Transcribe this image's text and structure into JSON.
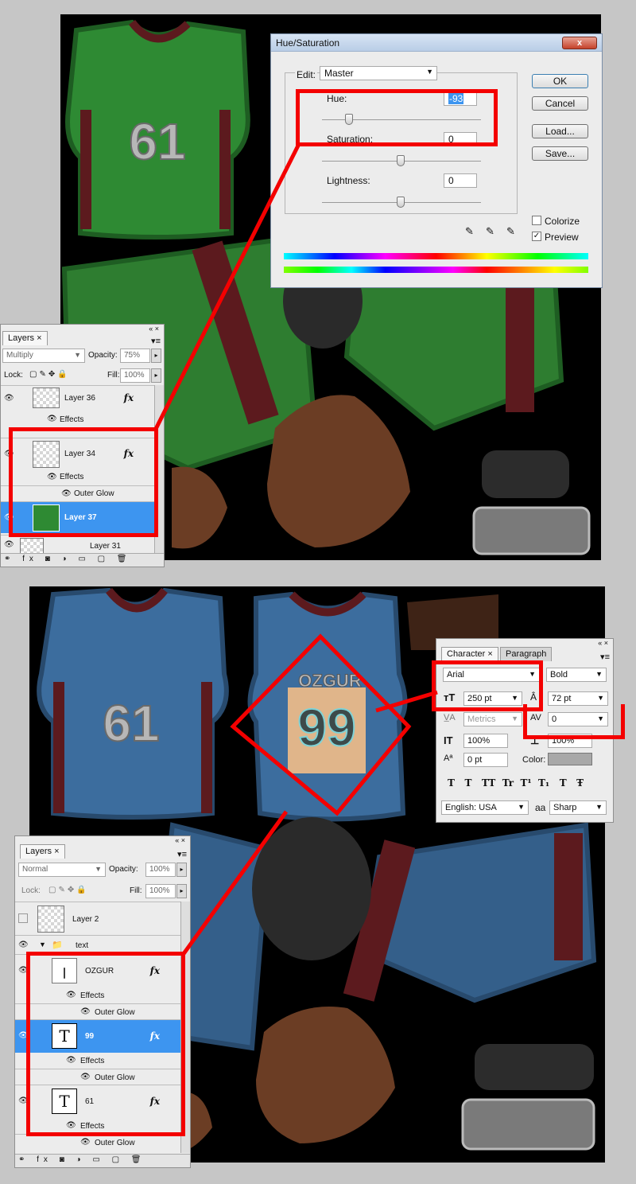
{
  "hue_sat": {
    "title": "Hue/Saturation",
    "close": "x",
    "edit_label": "Edit:",
    "edit_value": "Master",
    "hue_label": "Hue:",
    "hue_value": "-93",
    "sat_label": "Saturation:",
    "sat_value": "0",
    "light_label": "Lightness:",
    "light_value": "0",
    "ok": "OK",
    "cancel": "Cancel",
    "load": "Load...",
    "save": "Save...",
    "colorize": "Colorize",
    "preview": "Preview"
  },
  "layers_top": {
    "tab": "Layers",
    "blend": "Multiply",
    "opacity_label": "Opacity:",
    "opacity": "75%",
    "lock_label": "Lock:",
    "fill_label": "Fill:",
    "fill": "100%",
    "rows": [
      {
        "name": "Layer 36",
        "effects": "Effects"
      },
      {
        "name": "Layer 34",
        "effects": "Effects",
        "glow": "Outer Glow"
      },
      {
        "name": "Layer 37"
      },
      {
        "name": "Layer 31"
      }
    ],
    "fx": "fx"
  },
  "character": {
    "tab_char": "Character",
    "tab_para": "Paragraph",
    "font": "Arial",
    "style": "Bold",
    "size": "250 pt",
    "leading": "72 pt",
    "kerning": "Metrics",
    "tracking": "0",
    "vscale": "100%",
    "hscale": "100%",
    "baseline": "0 pt",
    "color_label": "Color:",
    "lang": "English: USA",
    "aa_icon": "aa",
    "aa": "Sharp",
    "styles": "T   T   TT  Tr  T¹  T₁   T   Ŧ"
  },
  "layers_bottom": {
    "tab": "Layers",
    "blend": "Normal",
    "opacity_label": "Opacity:",
    "opacity": "100%",
    "lock_label": "Lock:",
    "fill_label": "Fill:",
    "fill": "100%",
    "layer2": "Layer 2",
    "group": "text",
    "ozgur": "OZGUR",
    "l99": "99",
    "l61": "61",
    "effects": "Effects",
    "glow": "Outer Glow",
    "fx": "fx"
  },
  "jersey": {
    "top_number": "61",
    "bottom_number": "61",
    "player_name": "OZGUR",
    "player_number": "99"
  },
  "colors": {
    "green": "#2e8a33",
    "blue": "#3c6d9e",
    "maroon": "#5c1a1e",
    "highlight": "#ff0000",
    "selection": "#3d95f0"
  }
}
